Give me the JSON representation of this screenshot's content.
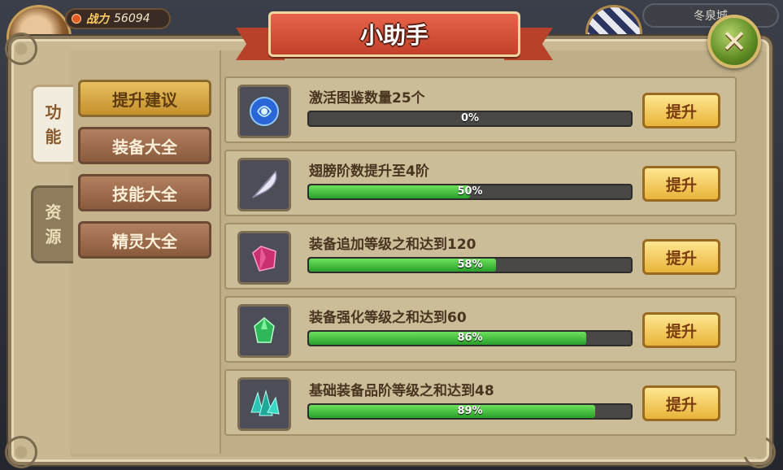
{
  "hud": {
    "power_label": "战力",
    "power_value": "56094",
    "city_label": "冬泉城"
  },
  "dialog": {
    "title": "小助手",
    "close_icon": "close-x-icon"
  },
  "side_tabs": [
    {
      "label_line1": "功",
      "label_line2": "能",
      "active": true
    },
    {
      "label_line1": "资",
      "label_line2": "源",
      "active": false
    }
  ],
  "menu": [
    {
      "label": "提升建议",
      "active": true
    },
    {
      "label": "装备大全",
      "active": false
    },
    {
      "label": "技能大全",
      "active": false
    },
    {
      "label": "精灵大全",
      "active": false
    }
  ],
  "items": [
    {
      "icon": "blue-crystal-orb-icon",
      "text": "激活图鉴数量25个",
      "progress_text": "0%",
      "progress": 0,
      "button": "提升"
    },
    {
      "icon": "white-feather-icon",
      "text": "翅膀阶数提升至4阶",
      "progress_text": "50%",
      "progress": 50,
      "button": "提升"
    },
    {
      "icon": "pink-crystal-icon",
      "text": "装备追加等级之和达到120",
      "progress_text": "58%",
      "progress": 58,
      "button": "提升"
    },
    {
      "icon": "green-gem-icon",
      "text": "装备强化等级之和达到60",
      "progress_text": "86%",
      "progress": 86,
      "button": "提升"
    },
    {
      "icon": "teal-crystal-cluster-icon",
      "text": "基础装备品阶等级之和达到48",
      "progress_text": "89%",
      "progress": 89,
      "button": "提升"
    }
  ],
  "colors": {
    "progress_fill": "#27a02a",
    "title_banner": "#c2402a",
    "frame": "#c9b892"
  }
}
